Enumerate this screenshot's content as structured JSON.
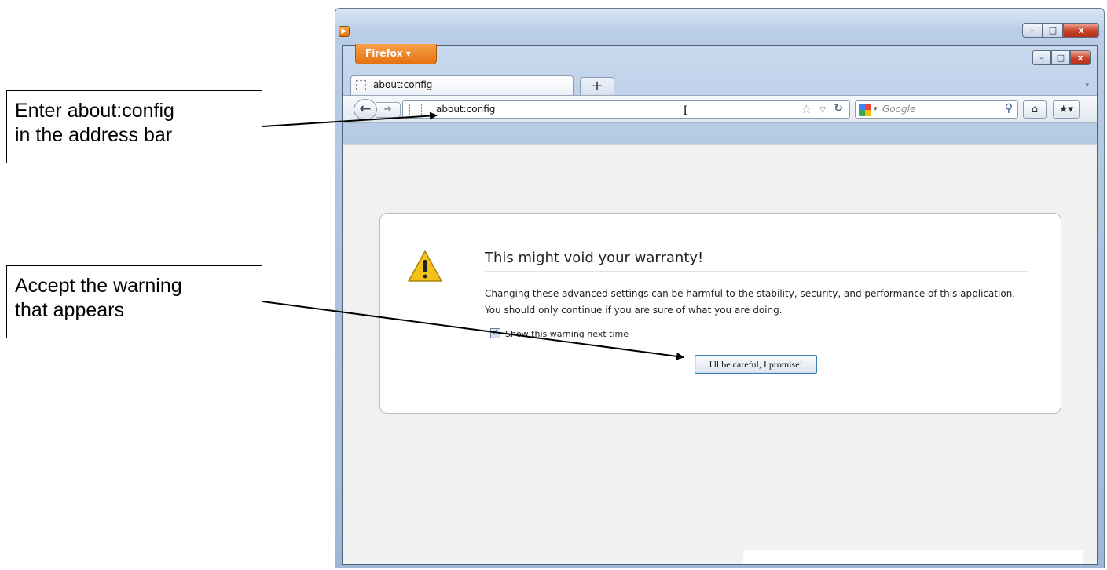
{
  "annotations": {
    "callout1": [
      "Enter about:config",
      "in the address bar"
    ],
    "callout2": [
      "Accept the warning",
      "that appears"
    ]
  },
  "window_controls": {
    "minimize": "–",
    "maximize": "□",
    "close": "x"
  },
  "browser": {
    "app_button": "Firefox ▾",
    "tab": {
      "title": "about:config"
    },
    "new_tab_label": "+",
    "address_bar": {
      "value": "about:config"
    },
    "search_bar": {
      "engine": "Google",
      "placeholder": "Google"
    }
  },
  "warning_page": {
    "title": "This might void your warranty!",
    "body": "Changing these advanced settings can be harmful to the stability, security, and performance of this application. You should only continue if you are sure of what you are doing.",
    "checkbox_label": "Show this warning next time",
    "checkbox_checked": true,
    "accept_button": "I'll be careful, I promise!"
  },
  "icons": {
    "app": "firefox-app-icon",
    "back": "back-arrow-icon",
    "forward": "forward-arrow-icon",
    "bookmark": "star-icon",
    "reload": "reload-icon",
    "search": "magnifier-icon",
    "home": "home-icon",
    "bookmarks": "bookmarks-icon",
    "warning": "warning-triangle-icon"
  },
  "colors": {
    "firefox_button": "#e5720f",
    "close_button": "#c8402a",
    "warning_yellow": "#f3c21a",
    "accept_button_border": "#3c7fb1"
  }
}
